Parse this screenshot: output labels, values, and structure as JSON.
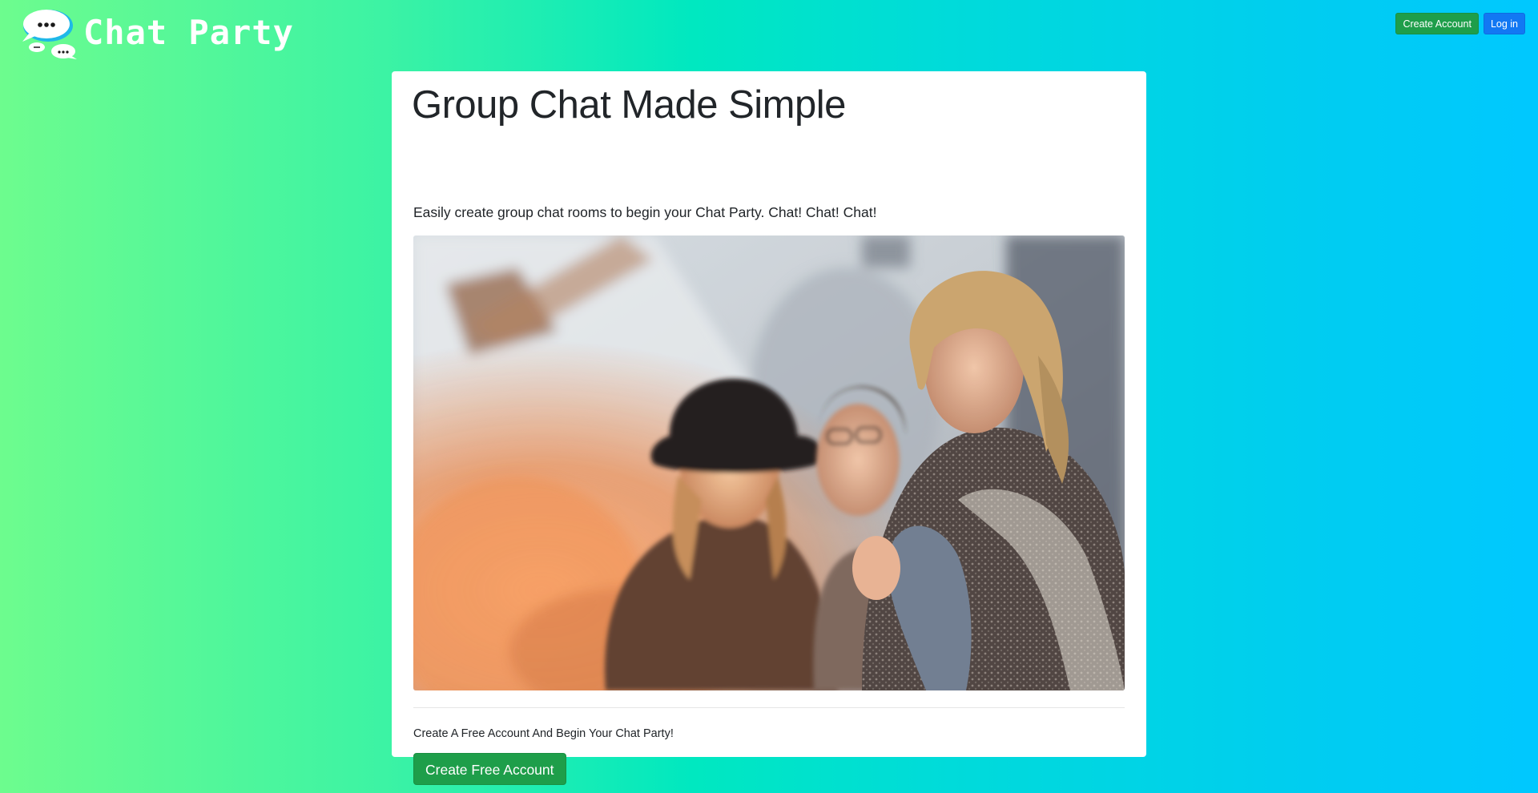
{
  "header": {
    "logo": {
      "text": "Chat Party",
      "icon": "chat-bubbles-icon"
    },
    "actions": {
      "create_account_label": "Create Account",
      "login_label": "Log in"
    }
  },
  "main": {
    "title": "Group Chat Made Simple",
    "lead": "Easily create group chat rooms to begin your Chat Party. Chat! Chat! Chat!",
    "hero_image": {
      "icon": "friends-photo"
    },
    "cta_text": "Create A Free Account And Begin Your Chat Party!",
    "cta_button_label": "Create Free Account"
  },
  "colors": {
    "gradient_start": "#6dfc8e",
    "gradient_end": "#00c8ff",
    "button_green": "#1e9e4a",
    "button_blue": "#1278f3",
    "card_background": "#ffffff"
  }
}
